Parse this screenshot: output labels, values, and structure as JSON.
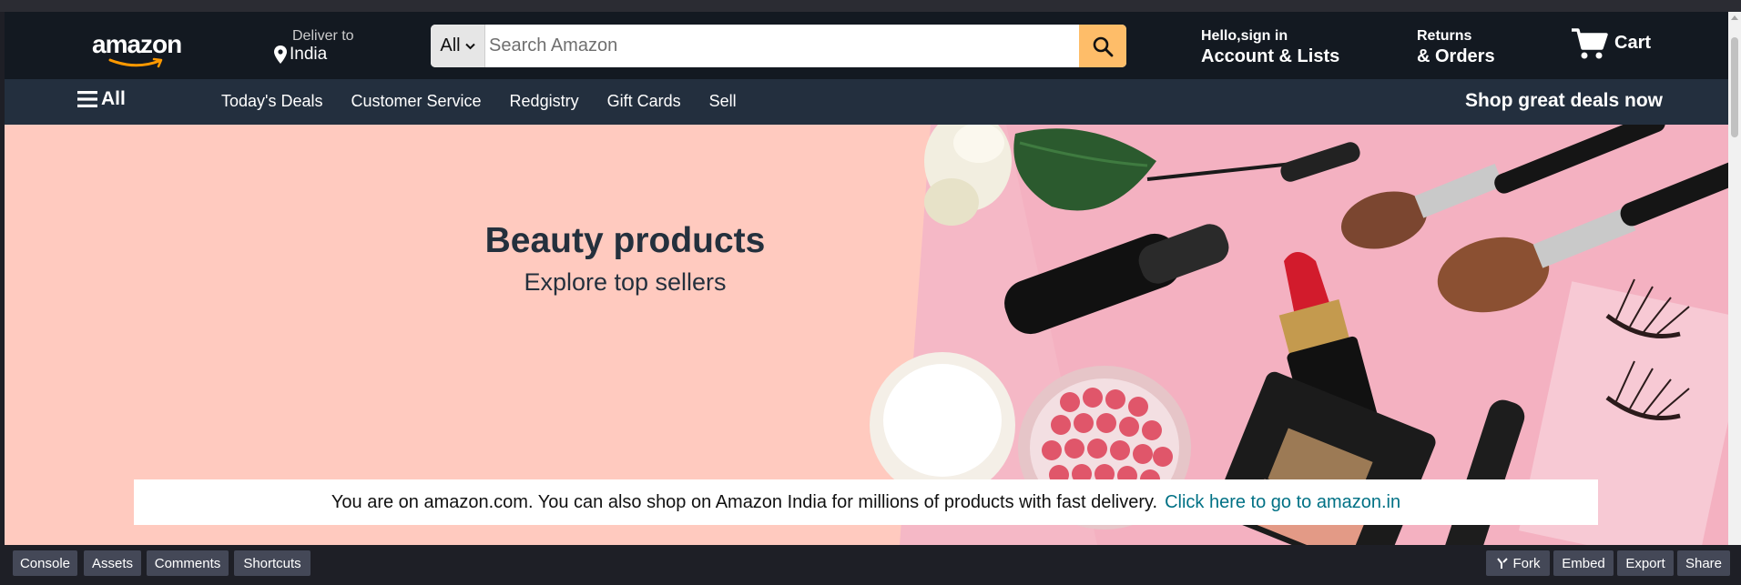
{
  "header": {
    "logo_text": "amazon",
    "deliver_to_label": "Deliver to",
    "deliver_to_location": "India",
    "search": {
      "category": "All",
      "placeholder": "Search Amazon",
      "value": ""
    },
    "account_greeting": "Hello,sign in",
    "account_label": "Account & Lists",
    "returns_label": "Returns",
    "orders_label": "& Orders",
    "cart_label": "Cart"
  },
  "subnav": {
    "all_label": "All",
    "links": [
      "Today's Deals",
      "Customer Service",
      "Redgistry",
      "Gift Cards",
      "Sell"
    ],
    "promo": "Shop great deals now"
  },
  "hero": {
    "title": "Beauty products",
    "subtitle": "Explore top sellers"
  },
  "notice": {
    "text": "You are on amazon.com. You can also shop on Amazon India for millions of products with fast delivery.",
    "link_text": "Click here to go to amazon.in"
  },
  "editor_bar": {
    "left_buttons": [
      "Console",
      "Assets",
      "Comments",
      "Shortcuts"
    ],
    "right_buttons": [
      "Fork",
      "Embed",
      "Export",
      "Share"
    ]
  },
  "colors": {
    "header_bg": "#131921",
    "subnav_bg": "#232f3e",
    "search_button": "#febd69",
    "hero_bg": "#ffcabf",
    "link": "#007185"
  }
}
